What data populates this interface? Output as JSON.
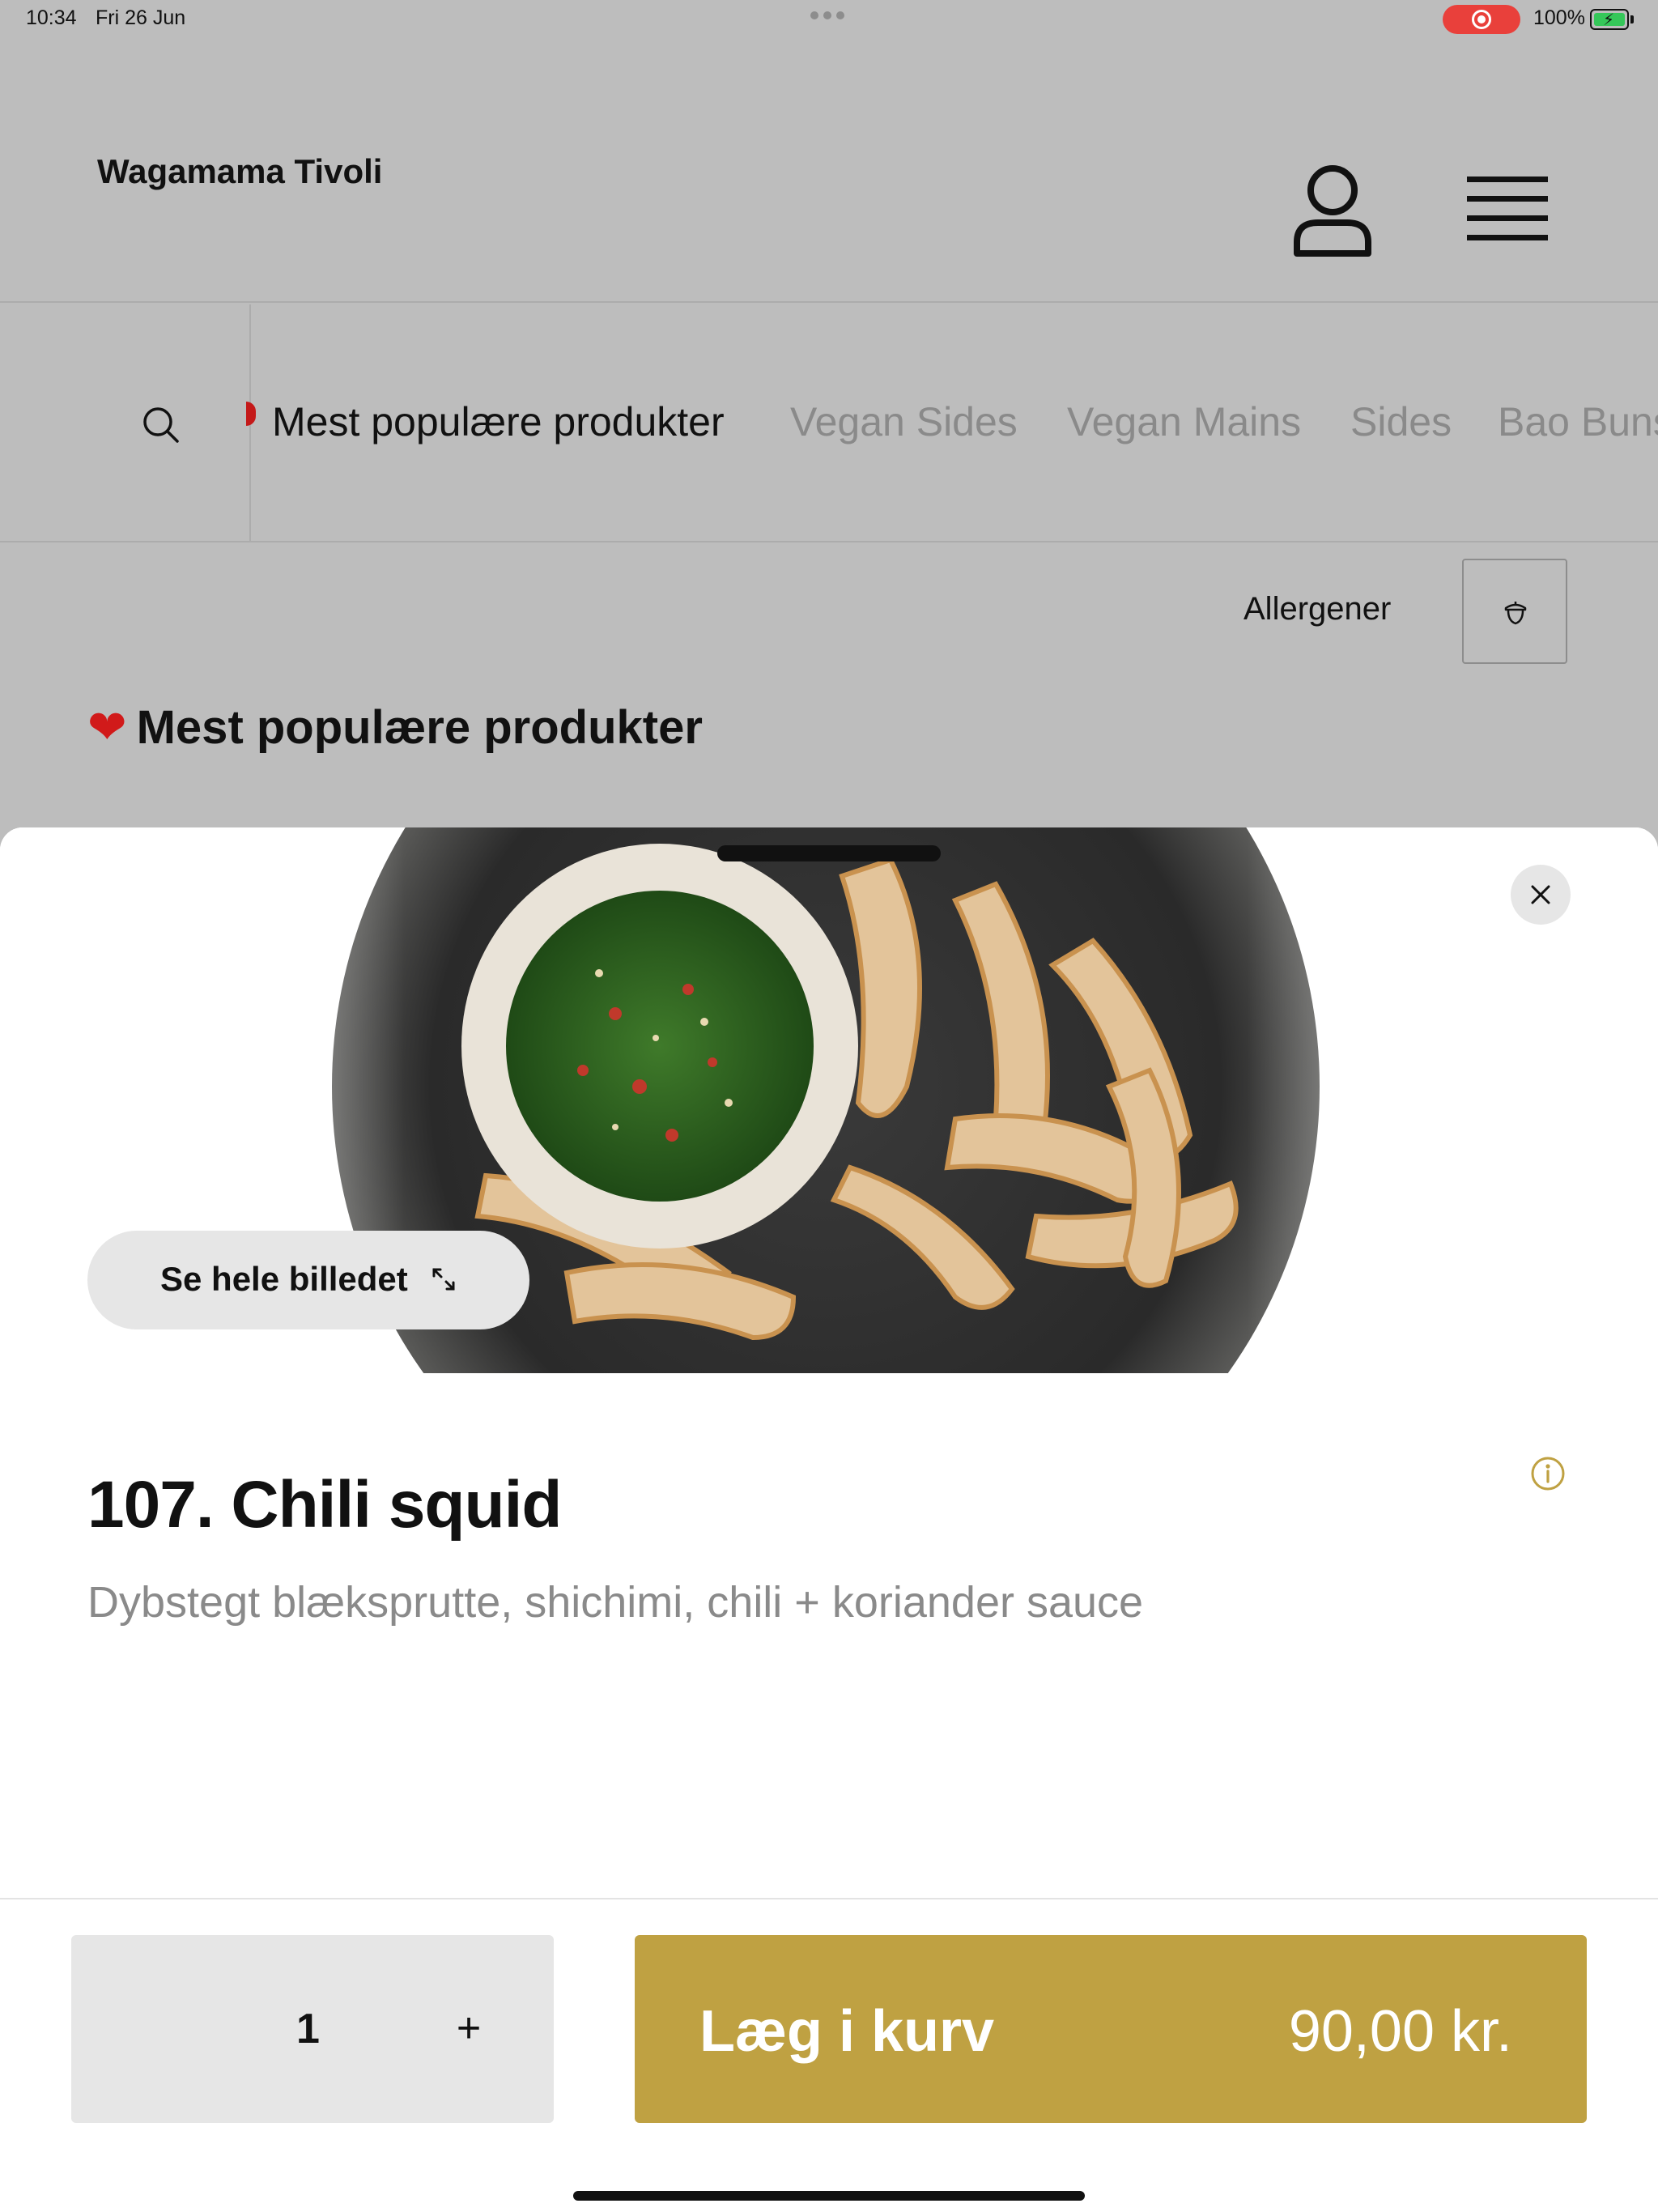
{
  "status_bar": {
    "time": "10:34",
    "date": "Fri 26 Jun",
    "battery": "100%"
  },
  "header": {
    "restaurant_name": "Wagamama Tivoli",
    "icons": {
      "account": "user-icon",
      "menu": "hamburger-menu-icon"
    }
  },
  "categories": {
    "active": "Mest populære produkter",
    "items": [
      "Vegan Sides",
      "Vegan Mains",
      "Sides",
      "Bao Buns"
    ]
  },
  "filter": {
    "label": "Allergener",
    "icon": "acorn-icon"
  },
  "section": {
    "heart": "❤",
    "title": "Mest populære produkter"
  },
  "product": {
    "view_image_label": "Se hele billedet",
    "title": "107. Chili squid",
    "description": "Dybstegt blæksprutte, shichimi, chili + koriander sauce",
    "quantity": "1",
    "add_label": "Læg i kurv",
    "price": "90,00 kr."
  },
  "colors": {
    "accent": "#bfa142",
    "overlay": "#bdbdbd",
    "recording": "#e9403b"
  }
}
